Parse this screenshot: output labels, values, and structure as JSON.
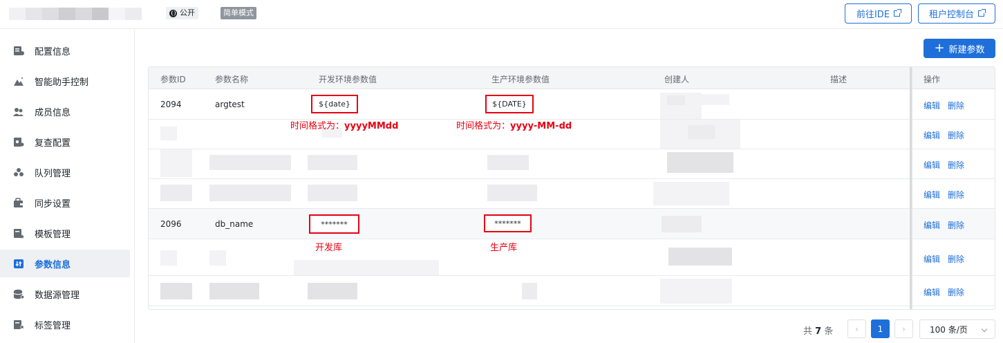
{
  "header": {
    "visibility_badge": "公开",
    "mode_badge": "简单模式",
    "ide_button": "前往IDE",
    "console_button": "租户控制台"
  },
  "sidebar": {
    "items": [
      {
        "label": "配置信息",
        "icon": "config-icon"
      },
      {
        "label": "智能助手控制",
        "icon": "assistant-icon"
      },
      {
        "label": "成员信息",
        "icon": "members-icon"
      },
      {
        "label": "复查配置",
        "icon": "review-icon"
      },
      {
        "label": "队列管理",
        "icon": "queue-icon"
      },
      {
        "label": "同步设置",
        "icon": "sync-icon"
      },
      {
        "label": "模板管理",
        "icon": "template-icon"
      },
      {
        "label": "参数信息",
        "icon": "params-icon",
        "active": true
      },
      {
        "label": "数据源管理",
        "icon": "datasource-icon"
      },
      {
        "label": "标签管理",
        "icon": "tag-icon"
      }
    ]
  },
  "toolbar": {
    "new_param_button": "新建参数"
  },
  "table": {
    "columns": [
      "参数ID",
      "参数名称",
      "开发环境参数值",
      "生产环境参数值",
      "创建人",
      "描述",
      "操作"
    ],
    "rows": [
      {
        "id": "2094",
        "name": "argtest",
        "dev_value": "${date}",
        "prod_value": "${DATE}"
      },
      {
        "id": "",
        "name": "",
        "dev_value": "",
        "prod_value": ""
      },
      {
        "id": "",
        "name": "",
        "dev_value": "",
        "prod_value": ""
      },
      {
        "id": "",
        "name": "",
        "dev_value": "",
        "prod_value": ""
      },
      {
        "id": "2096",
        "name": "db_name",
        "dev_value": "*******",
        "prod_value": "*******"
      },
      {
        "id": "",
        "name": "",
        "dev_value": "",
        "prod_value": ""
      },
      {
        "id": "",
        "name": "",
        "dev_value": "",
        "prod_value": ""
      }
    ],
    "edit_label": "编辑",
    "delete_label": "删除"
  },
  "annotations": {
    "dev_date_prefix": "时间格式为：",
    "dev_date_format": "yyyyMMdd",
    "prod_date_prefix": "时间格式为：",
    "prod_date_format": "yyyy-MM-dd",
    "dev_db": "开发库",
    "prod_db": "生产库"
  },
  "pagination": {
    "total_prefix": "共",
    "total_count": "7",
    "total_suffix": "条",
    "current_page": "1",
    "page_size": "100 条/页"
  },
  "colors": {
    "accent": "#1e6fd9",
    "annotation": "#e60012"
  }
}
